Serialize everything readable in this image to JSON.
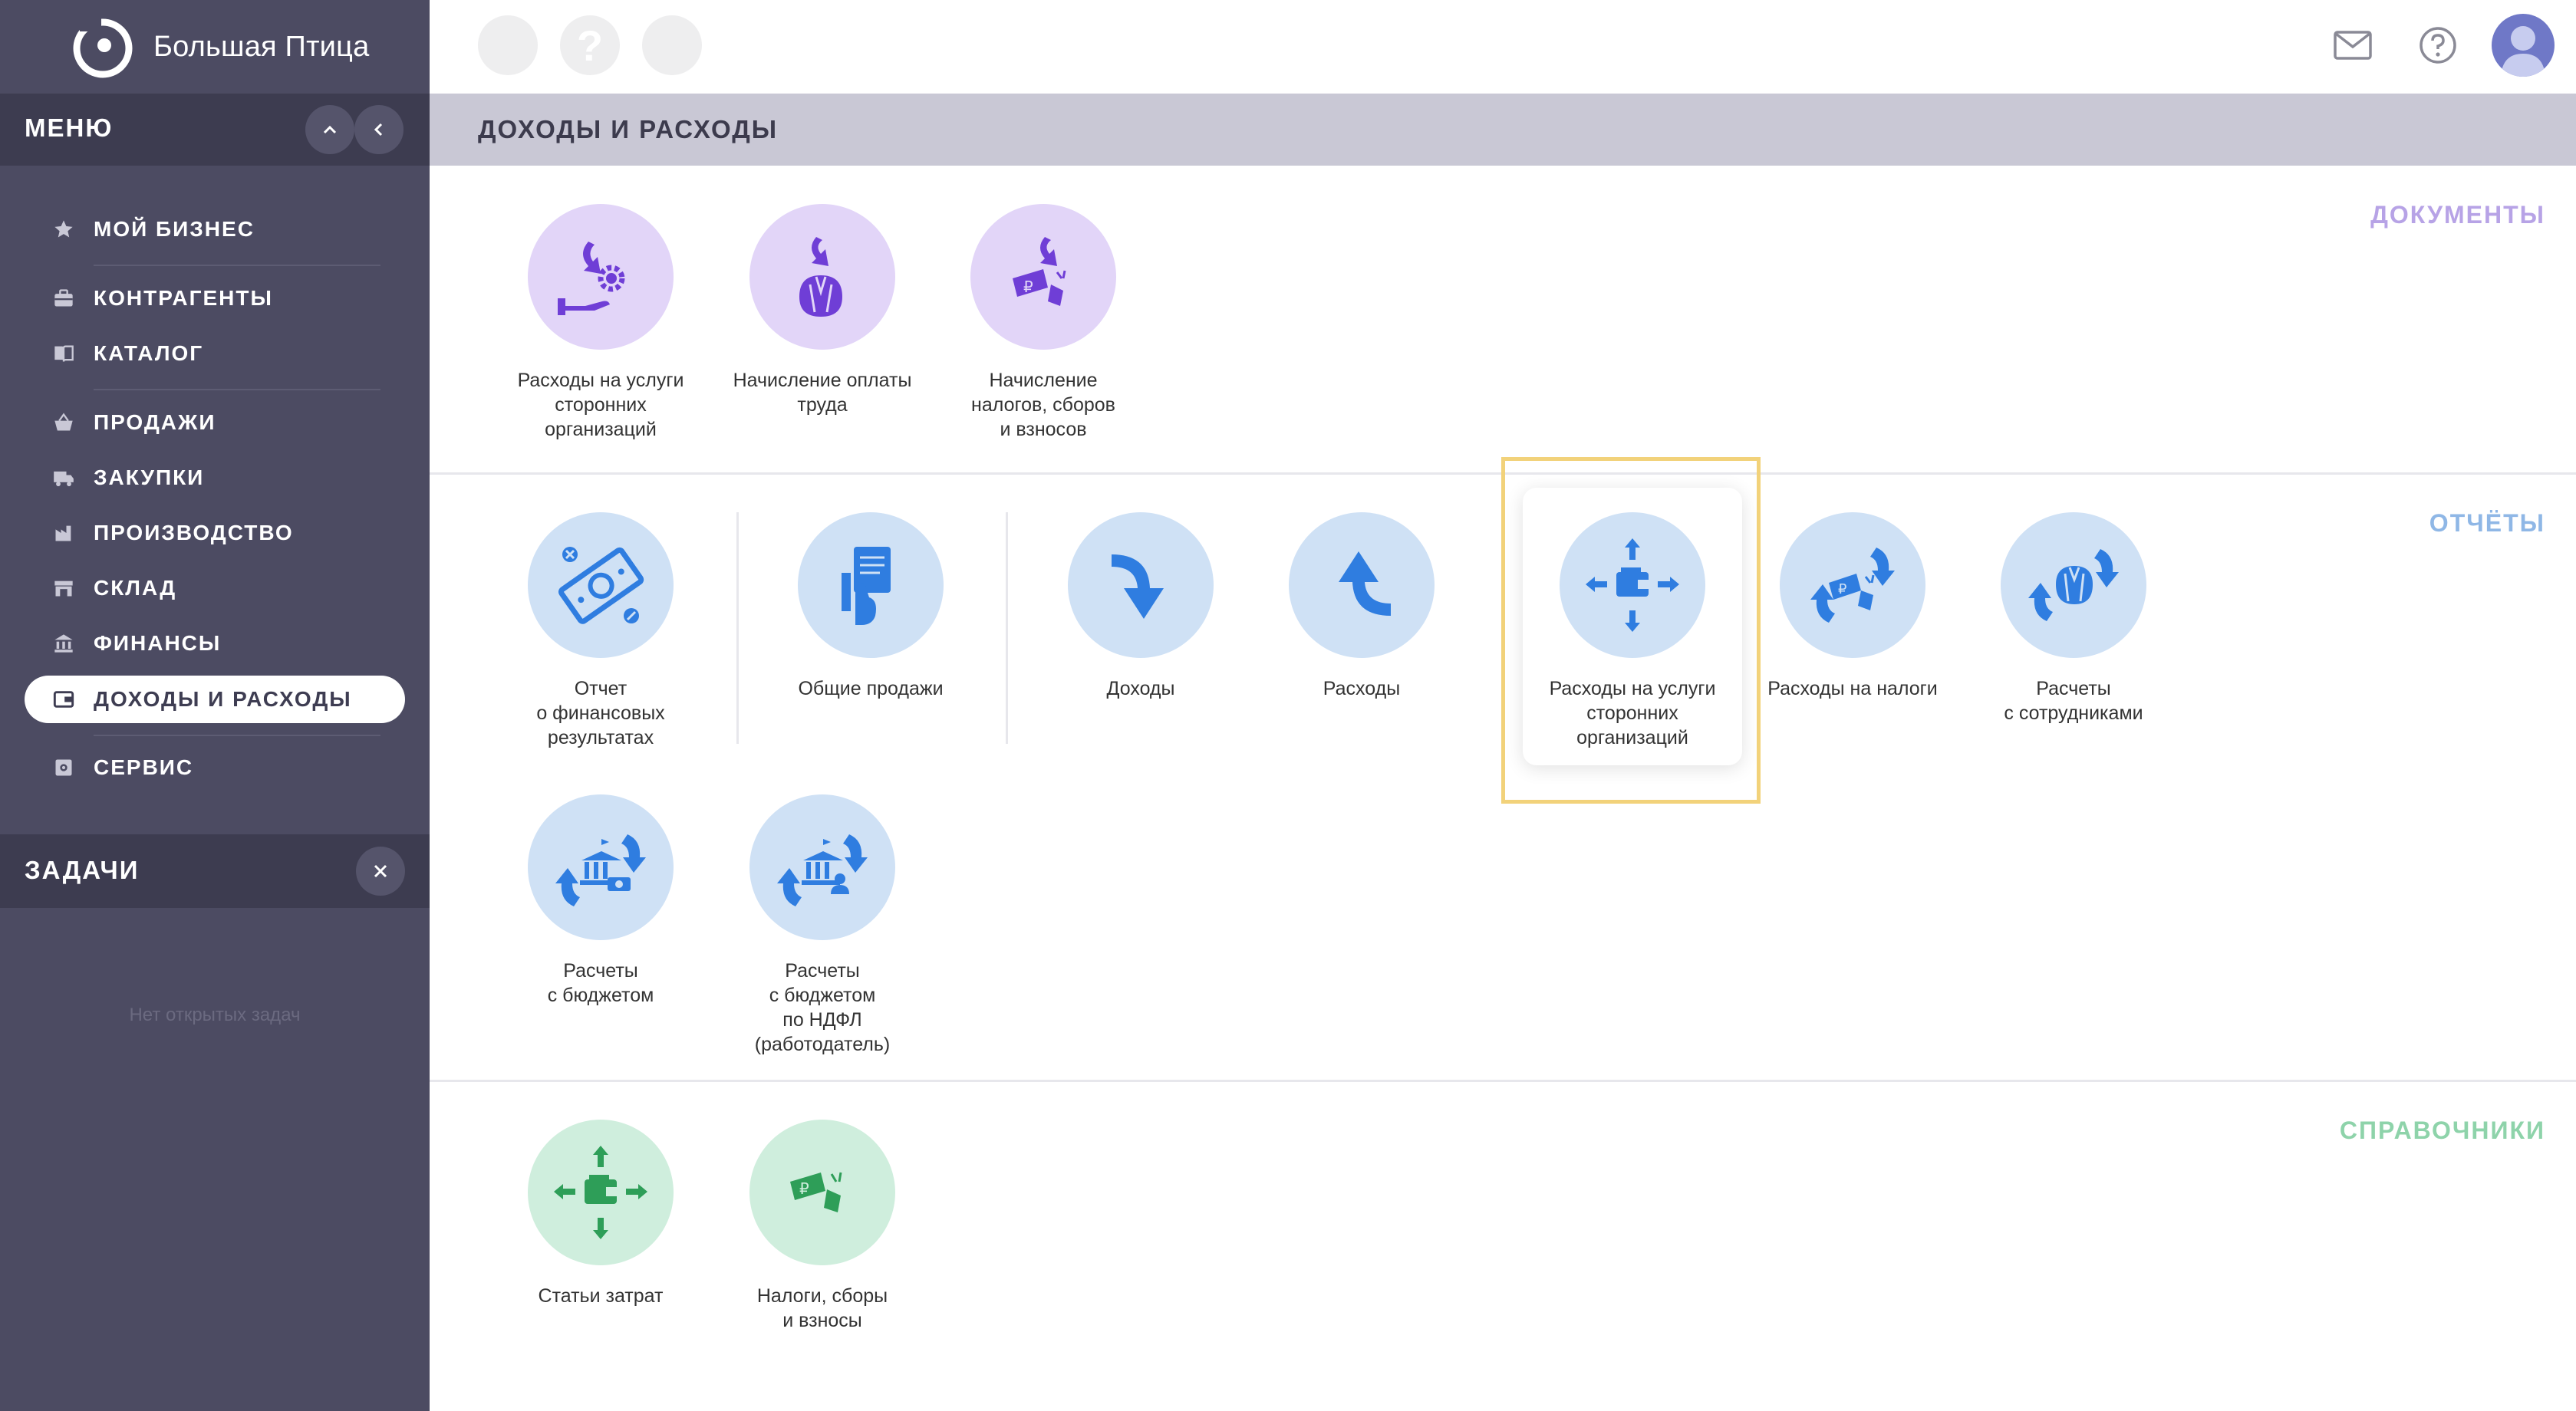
{
  "app": {
    "name": "Большая Птица"
  },
  "sidebar": {
    "menu_title": "МЕНЮ",
    "items": [
      {
        "label": "МОЙ БИЗНЕС",
        "icon": "star-icon"
      },
      {
        "label": "КОНТРАГЕНТЫ",
        "icon": "briefcase-icon"
      },
      {
        "label": "КАТАЛОГ",
        "icon": "book-icon"
      },
      {
        "label": "ПРОДАЖИ",
        "icon": "basket-icon"
      },
      {
        "label": "ЗАКУПКИ",
        "icon": "truck-icon"
      },
      {
        "label": "ПРОИЗВОДСТВО",
        "icon": "factory-icon"
      },
      {
        "label": "СКЛАД",
        "icon": "warehouse-icon"
      },
      {
        "label": "ФИНАНСЫ",
        "icon": "bank-icon"
      },
      {
        "label": "ДОХОДЫ И РАСХОДЫ",
        "icon": "wallet-icon",
        "active": true
      },
      {
        "label": "СЕРВИС",
        "icon": "gear-icon"
      }
    ],
    "tasks_title": "ЗАДАЧИ",
    "tasks_empty": "Нет открытых задач"
  },
  "topbar": {
    "help_glyph": "?",
    "icons": [
      "mail-icon",
      "help-icon",
      "avatar"
    ]
  },
  "page": {
    "title": "ДОХОДЫ И РАСХОДЫ"
  },
  "colors": {
    "sidebar_bg": "#4c4b62",
    "documents": "#b7a3e6",
    "reports": "#8fb7e6",
    "references": "#8ed3aa",
    "purple_icon": "#6f3ed6",
    "blue_icon": "#2f7de0",
    "green_icon": "#2e9e58",
    "highlight": "#f2d27a"
  },
  "sections": {
    "documents": {
      "title": "ДОКУМЕНТЫ",
      "tiles": [
        "Расходы на услуги\nсторонних\nорганизаций",
        "Начисление оплаты\nтруда",
        "Начисление\nналогов, сборов\nи взносов"
      ]
    },
    "reports": {
      "title": "ОТЧЁТЫ",
      "tiles": [
        "Отчет\nо финансовых\nрезультатах",
        "Общие продажи",
        "Доходы",
        "Расходы",
        "Расходы на услуги\nсторонних\nорганизаций",
        "Расходы на налоги",
        "Расчеты\nс сотрудниками",
        "Расчеты\nс бюджетом",
        "Расчеты\nс бюджетом\nпо НДФЛ\n(работодатель)"
      ]
    },
    "references": {
      "title": "СПРАВОЧНИКИ",
      "tiles": [
        "Статьи затрат",
        "Налоги, сборы\nи взносы"
      ]
    }
  }
}
